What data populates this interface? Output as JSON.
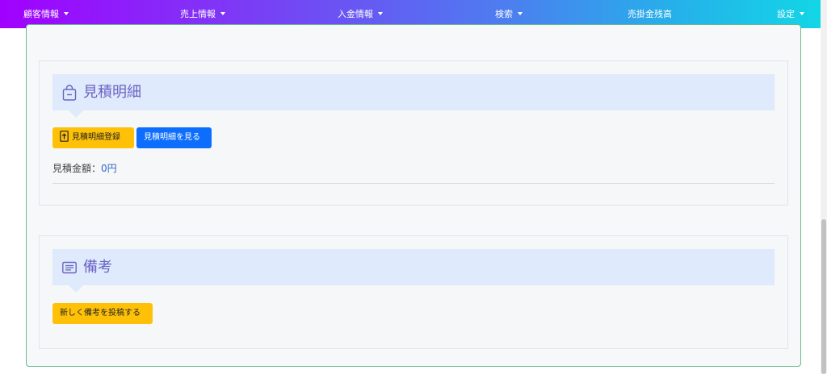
{
  "nav": {
    "items": [
      {
        "label": "顧客情報",
        "dropdown": true
      },
      {
        "label": "売上情報",
        "dropdown": true
      },
      {
        "label": "入金情報",
        "dropdown": true
      },
      {
        "label": "検索",
        "dropdown": true
      },
      {
        "label": "売掛金残高",
        "dropdown": false
      },
      {
        "label": "設定",
        "dropdown": true
      }
    ]
  },
  "estimate_panel": {
    "title": "見積明細",
    "icon": "shopping-bag-icon",
    "register_button": "見積明細登録",
    "register_icon": "upload-file-icon",
    "view_button": "見積明細を見る",
    "amount_label": "見積金額：",
    "amount_value": "0円"
  },
  "notes_panel": {
    "title": "備考",
    "icon": "card-text-icon",
    "new_note_button": "新しく備考を投稿する"
  },
  "colors": {
    "nav_gradient_start": "#a100ff",
    "nav_gradient_end": "#12d6e6",
    "panel_header_bg": "#dfeafc",
    "panel_title": "#6b63c4",
    "warning": "#ffc107",
    "primary": "#0d6efd",
    "card_border": "#69b98a"
  }
}
